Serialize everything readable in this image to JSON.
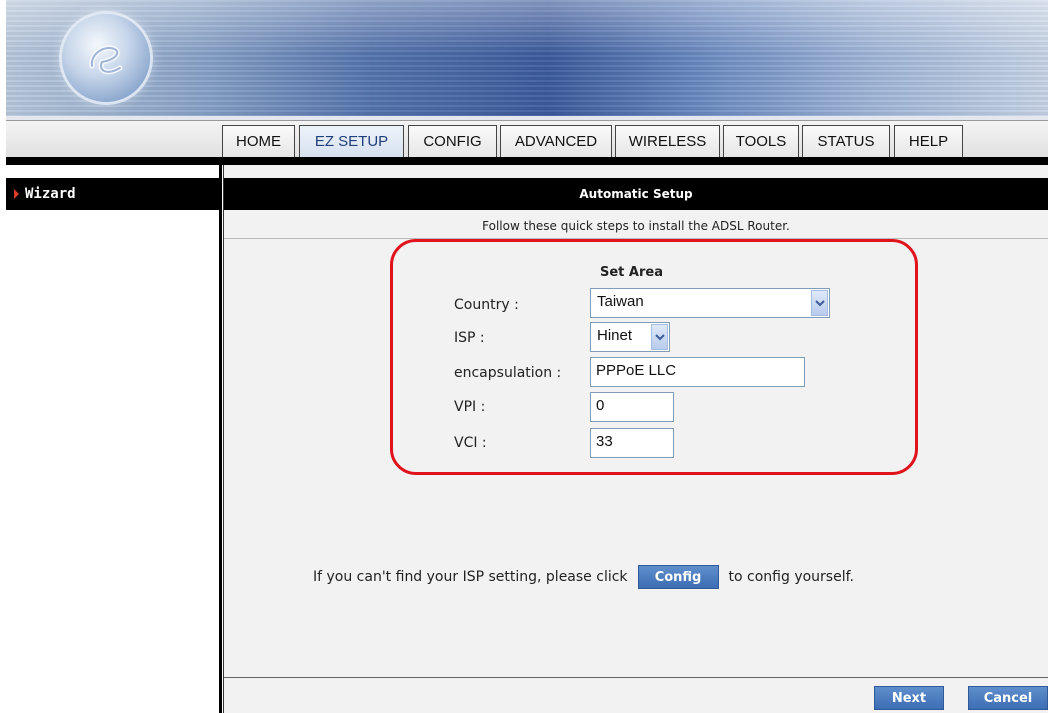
{
  "nav": {
    "tabs": [
      {
        "label": "HOME"
      },
      {
        "label": "EZ SETUP"
      },
      {
        "label": "CONFIG"
      },
      {
        "label": "ADVANCED"
      },
      {
        "label": "WIRELESS"
      },
      {
        "label": "TOOLS"
      },
      {
        "label": "STATUS"
      },
      {
        "label": "HELP"
      }
    ],
    "active": "EZ SETUP"
  },
  "sidebar": {
    "items": [
      {
        "label": "Wizard"
      }
    ]
  },
  "main": {
    "title": "Automatic Setup",
    "instruction": "Follow these quick steps to install the ADSL Router.",
    "section_title": "Set Area",
    "fields": {
      "country": {
        "label": "Country :",
        "value": "Taiwan"
      },
      "isp": {
        "label": "ISP :",
        "value": "Hinet"
      },
      "encapsulation": {
        "label": "encapsulation :",
        "value": "PPPoE LLC"
      },
      "vpi": {
        "label": "VPI :",
        "value": "0"
      },
      "vci": {
        "label": "VCI :",
        "value": "33"
      }
    },
    "help_text_before": "If you can't find your ISP setting, please click",
    "config_button": "Config",
    "help_text_after": "to config yourself.",
    "next_button": "Next",
    "cancel_button": "Cancel"
  },
  "colors": {
    "accent": "#3d6db3",
    "highlight": "#e0121c"
  }
}
